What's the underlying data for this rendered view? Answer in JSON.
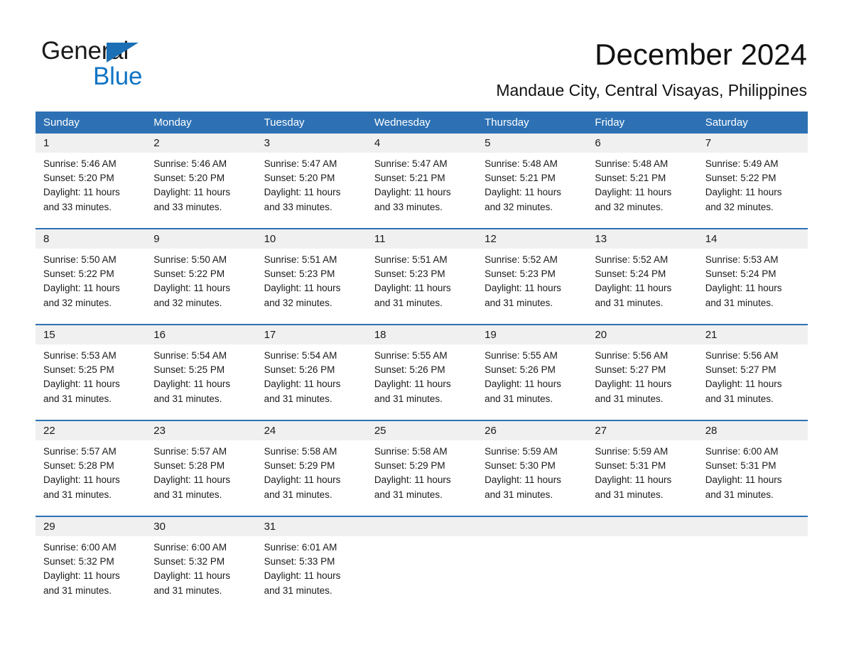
{
  "brand": {
    "name_part1": "General",
    "name_part2": "Blue",
    "accent_color": "#1175c4",
    "triangle_color": "#1b6fb5"
  },
  "header": {
    "title": "December 2024",
    "subtitle": "Mandaue City, Central Visayas, Philippines"
  },
  "calendar": {
    "header_bg": "#2d71b4",
    "daynum_bg": "#f0f0f0",
    "weekdays": [
      "Sunday",
      "Monday",
      "Tuesday",
      "Wednesday",
      "Thursday",
      "Friday",
      "Saturday"
    ],
    "weeks": [
      [
        {
          "day": "1",
          "sunrise": "Sunrise: 5:46 AM",
          "sunset": "Sunset: 5:20 PM",
          "daylight_line1": "Daylight: 11 hours",
          "daylight_line2": "and 33 minutes."
        },
        {
          "day": "2",
          "sunrise": "Sunrise: 5:46 AM",
          "sunset": "Sunset: 5:20 PM",
          "daylight_line1": "Daylight: 11 hours",
          "daylight_line2": "and 33 minutes."
        },
        {
          "day": "3",
          "sunrise": "Sunrise: 5:47 AM",
          "sunset": "Sunset: 5:20 PM",
          "daylight_line1": "Daylight: 11 hours",
          "daylight_line2": "and 33 minutes."
        },
        {
          "day": "4",
          "sunrise": "Sunrise: 5:47 AM",
          "sunset": "Sunset: 5:21 PM",
          "daylight_line1": "Daylight: 11 hours",
          "daylight_line2": "and 33 minutes."
        },
        {
          "day": "5",
          "sunrise": "Sunrise: 5:48 AM",
          "sunset": "Sunset: 5:21 PM",
          "daylight_line1": "Daylight: 11 hours",
          "daylight_line2": "and 32 minutes."
        },
        {
          "day": "6",
          "sunrise": "Sunrise: 5:48 AM",
          "sunset": "Sunset: 5:21 PM",
          "daylight_line1": "Daylight: 11 hours",
          "daylight_line2": "and 32 minutes."
        },
        {
          "day": "7",
          "sunrise": "Sunrise: 5:49 AM",
          "sunset": "Sunset: 5:22 PM",
          "daylight_line1": "Daylight: 11 hours",
          "daylight_line2": "and 32 minutes."
        }
      ],
      [
        {
          "day": "8",
          "sunrise": "Sunrise: 5:50 AM",
          "sunset": "Sunset: 5:22 PM",
          "daylight_line1": "Daylight: 11 hours",
          "daylight_line2": "and 32 minutes."
        },
        {
          "day": "9",
          "sunrise": "Sunrise: 5:50 AM",
          "sunset": "Sunset: 5:22 PM",
          "daylight_line1": "Daylight: 11 hours",
          "daylight_line2": "and 32 minutes."
        },
        {
          "day": "10",
          "sunrise": "Sunrise: 5:51 AM",
          "sunset": "Sunset: 5:23 PM",
          "daylight_line1": "Daylight: 11 hours",
          "daylight_line2": "and 32 minutes."
        },
        {
          "day": "11",
          "sunrise": "Sunrise: 5:51 AM",
          "sunset": "Sunset: 5:23 PM",
          "daylight_line1": "Daylight: 11 hours",
          "daylight_line2": "and 31 minutes."
        },
        {
          "day": "12",
          "sunrise": "Sunrise: 5:52 AM",
          "sunset": "Sunset: 5:23 PM",
          "daylight_line1": "Daylight: 11 hours",
          "daylight_line2": "and 31 minutes."
        },
        {
          "day": "13",
          "sunrise": "Sunrise: 5:52 AM",
          "sunset": "Sunset: 5:24 PM",
          "daylight_line1": "Daylight: 11 hours",
          "daylight_line2": "and 31 minutes."
        },
        {
          "day": "14",
          "sunrise": "Sunrise: 5:53 AM",
          "sunset": "Sunset: 5:24 PM",
          "daylight_line1": "Daylight: 11 hours",
          "daylight_line2": "and 31 minutes."
        }
      ],
      [
        {
          "day": "15",
          "sunrise": "Sunrise: 5:53 AM",
          "sunset": "Sunset: 5:25 PM",
          "daylight_line1": "Daylight: 11 hours",
          "daylight_line2": "and 31 minutes."
        },
        {
          "day": "16",
          "sunrise": "Sunrise: 5:54 AM",
          "sunset": "Sunset: 5:25 PM",
          "daylight_line1": "Daylight: 11 hours",
          "daylight_line2": "and 31 minutes."
        },
        {
          "day": "17",
          "sunrise": "Sunrise: 5:54 AM",
          "sunset": "Sunset: 5:26 PM",
          "daylight_line1": "Daylight: 11 hours",
          "daylight_line2": "and 31 minutes."
        },
        {
          "day": "18",
          "sunrise": "Sunrise: 5:55 AM",
          "sunset": "Sunset: 5:26 PM",
          "daylight_line1": "Daylight: 11 hours",
          "daylight_line2": "and 31 minutes."
        },
        {
          "day": "19",
          "sunrise": "Sunrise: 5:55 AM",
          "sunset": "Sunset: 5:26 PM",
          "daylight_line1": "Daylight: 11 hours",
          "daylight_line2": "and 31 minutes."
        },
        {
          "day": "20",
          "sunrise": "Sunrise: 5:56 AM",
          "sunset": "Sunset: 5:27 PM",
          "daylight_line1": "Daylight: 11 hours",
          "daylight_line2": "and 31 minutes."
        },
        {
          "day": "21",
          "sunrise": "Sunrise: 5:56 AM",
          "sunset": "Sunset: 5:27 PM",
          "daylight_line1": "Daylight: 11 hours",
          "daylight_line2": "and 31 minutes."
        }
      ],
      [
        {
          "day": "22",
          "sunrise": "Sunrise: 5:57 AM",
          "sunset": "Sunset: 5:28 PM",
          "daylight_line1": "Daylight: 11 hours",
          "daylight_line2": "and 31 minutes."
        },
        {
          "day": "23",
          "sunrise": "Sunrise: 5:57 AM",
          "sunset": "Sunset: 5:28 PM",
          "daylight_line1": "Daylight: 11 hours",
          "daylight_line2": "and 31 minutes."
        },
        {
          "day": "24",
          "sunrise": "Sunrise: 5:58 AM",
          "sunset": "Sunset: 5:29 PM",
          "daylight_line1": "Daylight: 11 hours",
          "daylight_line2": "and 31 minutes."
        },
        {
          "day": "25",
          "sunrise": "Sunrise: 5:58 AM",
          "sunset": "Sunset: 5:29 PM",
          "daylight_line1": "Daylight: 11 hours",
          "daylight_line2": "and 31 minutes."
        },
        {
          "day": "26",
          "sunrise": "Sunrise: 5:59 AM",
          "sunset": "Sunset: 5:30 PM",
          "daylight_line1": "Daylight: 11 hours",
          "daylight_line2": "and 31 minutes."
        },
        {
          "day": "27",
          "sunrise": "Sunrise: 5:59 AM",
          "sunset": "Sunset: 5:31 PM",
          "daylight_line1": "Daylight: 11 hours",
          "daylight_line2": "and 31 minutes."
        },
        {
          "day": "28",
          "sunrise": "Sunrise: 6:00 AM",
          "sunset": "Sunset: 5:31 PM",
          "daylight_line1": "Daylight: 11 hours",
          "daylight_line2": "and 31 minutes."
        }
      ],
      [
        {
          "day": "29",
          "sunrise": "Sunrise: 6:00 AM",
          "sunset": "Sunset: 5:32 PM",
          "daylight_line1": "Daylight: 11 hours",
          "daylight_line2": "and 31 minutes."
        },
        {
          "day": "30",
          "sunrise": "Sunrise: 6:00 AM",
          "sunset": "Sunset: 5:32 PM",
          "daylight_line1": "Daylight: 11 hours",
          "daylight_line2": "and 31 minutes."
        },
        {
          "day": "31",
          "sunrise": "Sunrise: 6:01 AM",
          "sunset": "Sunset: 5:33 PM",
          "daylight_line1": "Daylight: 11 hours",
          "daylight_line2": "and 31 minutes."
        },
        {
          "day": "",
          "sunrise": "",
          "sunset": "",
          "daylight_line1": "",
          "daylight_line2": ""
        },
        {
          "day": "",
          "sunrise": "",
          "sunset": "",
          "daylight_line1": "",
          "daylight_line2": ""
        },
        {
          "day": "",
          "sunrise": "",
          "sunset": "",
          "daylight_line1": "",
          "daylight_line2": ""
        },
        {
          "day": "",
          "sunrise": "",
          "sunset": "",
          "daylight_line1": "",
          "daylight_line2": ""
        }
      ]
    ]
  }
}
